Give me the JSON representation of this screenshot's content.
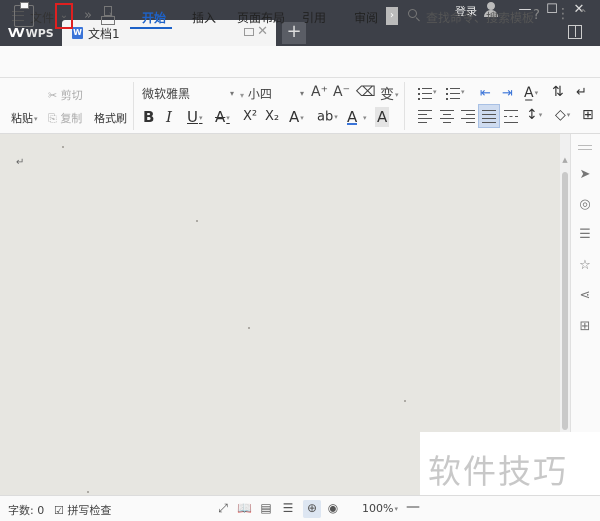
{
  "titlebar": {
    "app_tab": "WPS",
    "doc_tab": "文档1",
    "doc_icon": "W",
    "login": "登录",
    "add_tab": "+"
  },
  "menubar": {
    "file_label": "文件",
    "tabs": [
      "开始",
      "插入",
      "页面布局",
      "引用",
      "审阅"
    ],
    "active_tab": "开始",
    "search_placeholder": "查找命令、搜索模板",
    "help": "?",
    "more": "⋮"
  },
  "toolbar": {
    "paste": "粘贴",
    "cut": "剪切",
    "copy": "复制",
    "format_painter": "格式刷",
    "font_name": "微软雅黑",
    "font_size": "小四",
    "bold": "B",
    "italic": "I",
    "underline": "U",
    "strike": "A",
    "superscript": "X²",
    "subscript": "X₂",
    "grow_font": "A⁺",
    "shrink_font": "A⁻",
    "phonetic": "变"
  },
  "document": {
    "paragraph_mark": "↵"
  },
  "watermark": "软件技巧",
  "statusbar": {
    "word_count": "字数: 0",
    "spell_check": "拼写检查",
    "zoom": "100%"
  },
  "colors": {
    "titlebar_bg": "#3d4048",
    "accent": "#1e62c8",
    "highlight_box": "#e02020",
    "doc_bg": "#e7e6e1"
  }
}
